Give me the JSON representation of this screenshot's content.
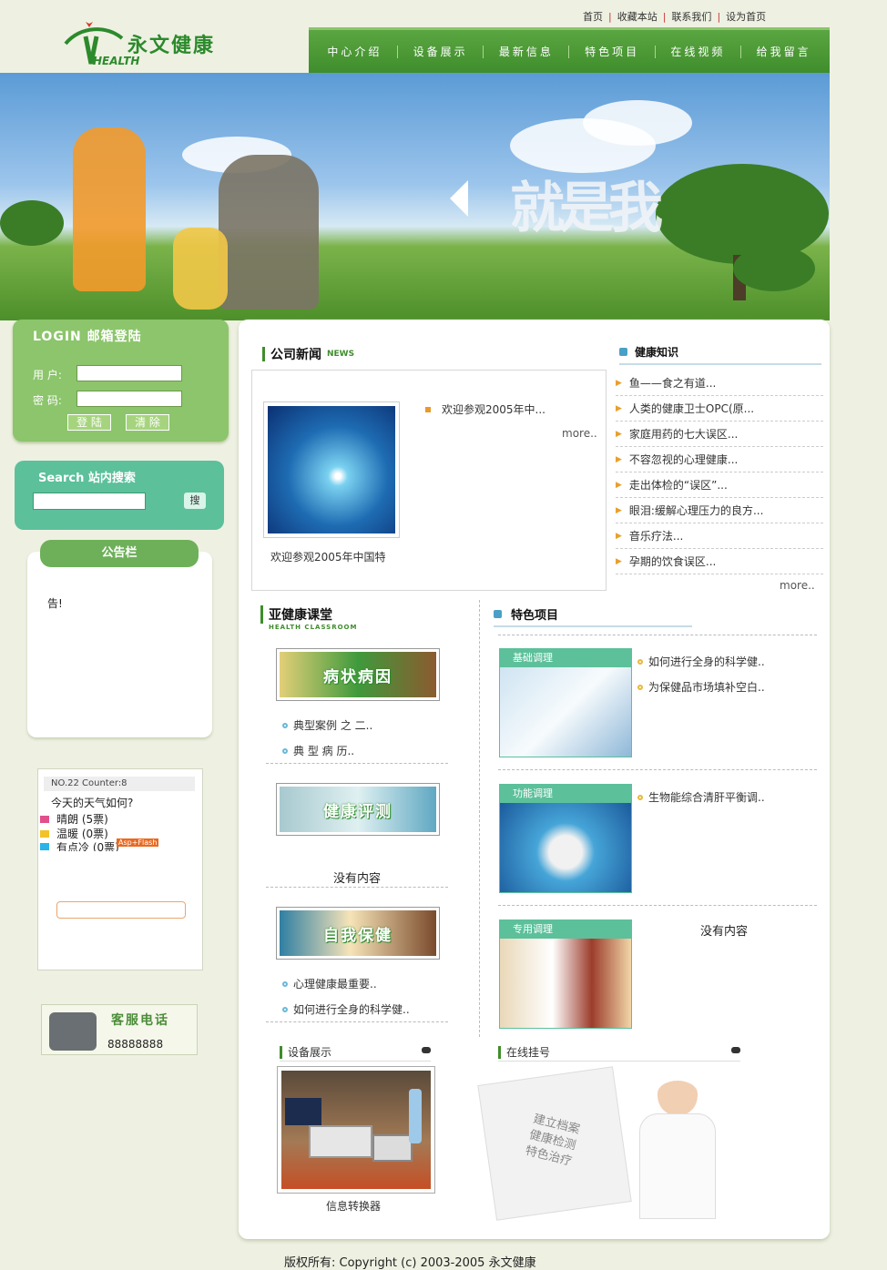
{
  "toplinks": [
    "首页",
    "收藏本站",
    "联系我们",
    "设为首页"
  ],
  "logo": {
    "name": "永文健康",
    "sub": "HEALTH"
  },
  "nav": [
    "中心介绍",
    "设备展示",
    "最新信息",
    "特色项目",
    "在线视频",
    "给我留言"
  ],
  "banner": {
    "text": "就是我"
  },
  "login": {
    "title": "LOGIN 邮箱登陆",
    "user_label": "用 户:",
    "pass_label": "密 码:",
    "login_btn": "登 陆",
    "clear_btn": "清 除"
  },
  "search": {
    "title": "Search 站内搜索",
    "go": "搜"
  },
  "notice": {
    "title": "公告栏",
    "content": "告!"
  },
  "vote": {
    "header": "NO.22  Counter:8",
    "question": "今天的天气如何?",
    "options": [
      {
        "label": "晴朗 (5票)",
        "color": "#e0508a"
      },
      {
        "label": "温暖 (0票)",
        "color": "#f2c228"
      },
      {
        "label": "有点冷 (0票)",
        "color": "#2ab4e8"
      }
    ],
    "tag": "Asp+Flash"
  },
  "phone": {
    "title": "客服电话",
    "number": "88888888"
  },
  "news": {
    "title": "公司新闻",
    "en": "NEWS",
    "caption": "欢迎参观2005年中国特",
    "item": "欢迎参观2005年中...",
    "more": "more.."
  },
  "health": {
    "title": "健康知识",
    "items": [
      "鱼——食之有道...",
      "人类的健康卫士OPC(原...",
      "家庭用药的七大误区...",
      "不容忽视的心理健康...",
      "走出体检的“误区”...",
      "眼泪:缓解心理压力的良方...",
      "音乐疗法...",
      "孕期的饮食误区..."
    ],
    "more": "more.."
  },
  "classroom": {
    "title": "亚健康课堂",
    "en": "HEALTH CLASSROOM",
    "img1": "病状病因",
    "img2": "健康评测",
    "img3": "自我保健",
    "rows1": [
      "典型案例 之 二..",
      "典 型 病 历.."
    ],
    "empty": "没有内容",
    "rows3": [
      "心理健康最重要..",
      "如何进行全身的科学健.."
    ]
  },
  "feature": {
    "title": "特色项目",
    "tab1": "基础调理",
    "tab2": "功能调理",
    "tab3": "专用调理",
    "rows1": [
      "如何进行全身的科学健..",
      "为保健品市场填补空白.."
    ],
    "rows2": [
      "生物能综合清肝平衡调.."
    ],
    "empty": "没有内容"
  },
  "device": {
    "title": "设备展示",
    "caption": "信息转换器"
  },
  "register": {
    "title": "在线挂号",
    "notes": [
      "建立档案",
      "健康检测",
      "特色治疗"
    ]
  },
  "copyright": "版权所有: Copyright (c) 2003-2005 永文健康"
}
